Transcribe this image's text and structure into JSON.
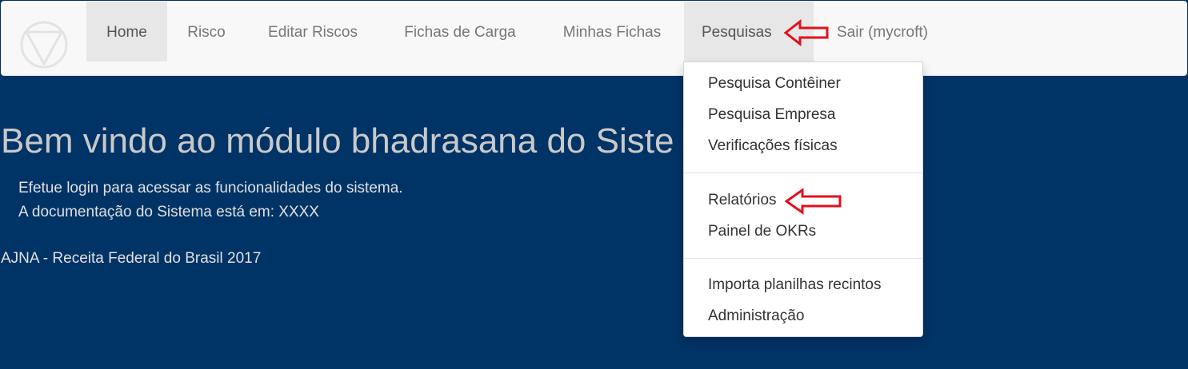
{
  "navbar": {
    "logo_icon": "circle-triangle-logo-icon",
    "items": [
      {
        "label": "Home"
      },
      {
        "label": "Risco"
      },
      {
        "label": "Editar Riscos"
      },
      {
        "label": "Fichas de Carga"
      },
      {
        "label": "Minhas Fichas"
      },
      {
        "label": "Pesquisas"
      },
      {
        "label": "Sair (mycroft)"
      }
    ]
  },
  "dropdown": {
    "items": [
      {
        "label": "Pesquisa Contêiner"
      },
      {
        "label": "Pesquisa Empresa"
      },
      {
        "label": "Verificações físicas"
      },
      {
        "label": "Relatórios"
      },
      {
        "label": "Painel de OKRs"
      },
      {
        "label": "Importa planilhas recintos"
      },
      {
        "label": "Administração"
      }
    ]
  },
  "main": {
    "title": "Bem vindo ao módulo bhadrasana do Siste",
    "lines": [
      "Efetue login para acessar as funcionalidades do sistema.",
      "A documentação do Sistema está em: XXXX"
    ],
    "footer": "AJNA - Receita Federal do Brasil 2017"
  },
  "annotations": {
    "arrow_color": "#e3101c",
    "arrow_icon": "red-left-arrow-icon"
  },
  "colors": {
    "page_background": "#003366",
    "navbar_background": "#f8f8f8"
  }
}
